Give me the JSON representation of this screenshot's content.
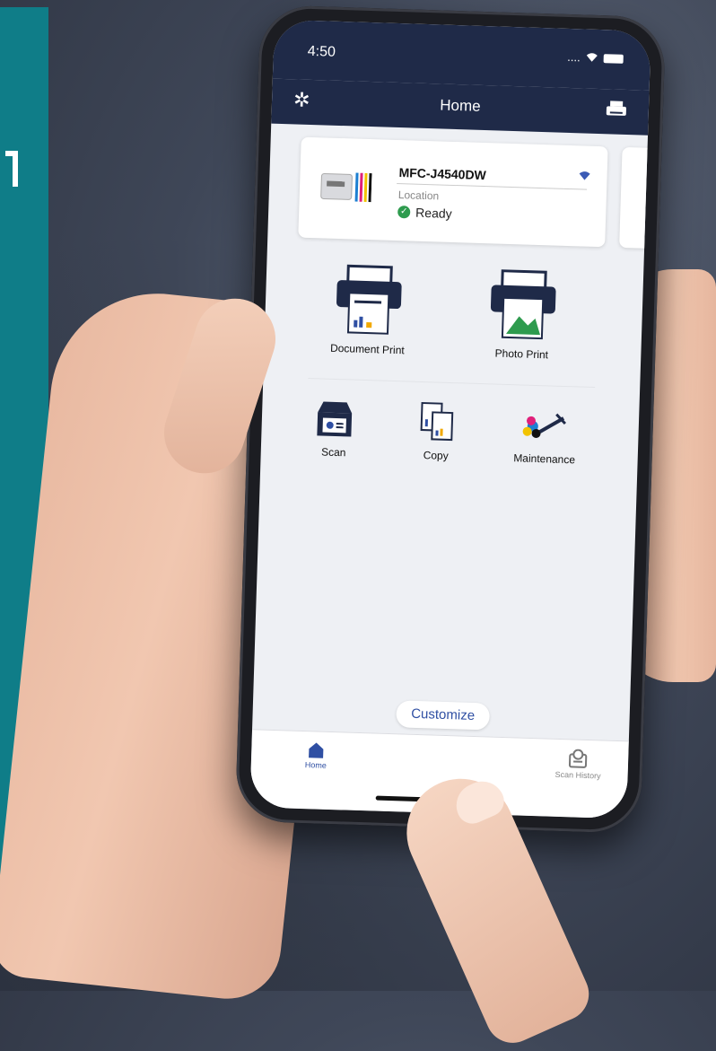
{
  "status": {
    "time": "4:50",
    "signal": "....",
    "wifi_glyph": "▲"
  },
  "nav": {
    "title": "Home",
    "settings_icon": "gear-icon",
    "printer_icon": "printer-icon"
  },
  "device": {
    "name": "MFC-J4540DW",
    "location": "Location",
    "status": "Ready",
    "status_color": "#2e9b4e"
  },
  "actions": {
    "document_print": "Document Print",
    "photo_print": "Photo Print",
    "scan": "Scan",
    "copy": "Copy",
    "maintenance": "Maintenance"
  },
  "customize_label": "Customize",
  "tabs": {
    "home": "Home",
    "scan_history": "Scan History"
  },
  "colors": {
    "brand": "#1f2a48",
    "accent": "#2f4fa3",
    "teal": "#0f7d88"
  }
}
